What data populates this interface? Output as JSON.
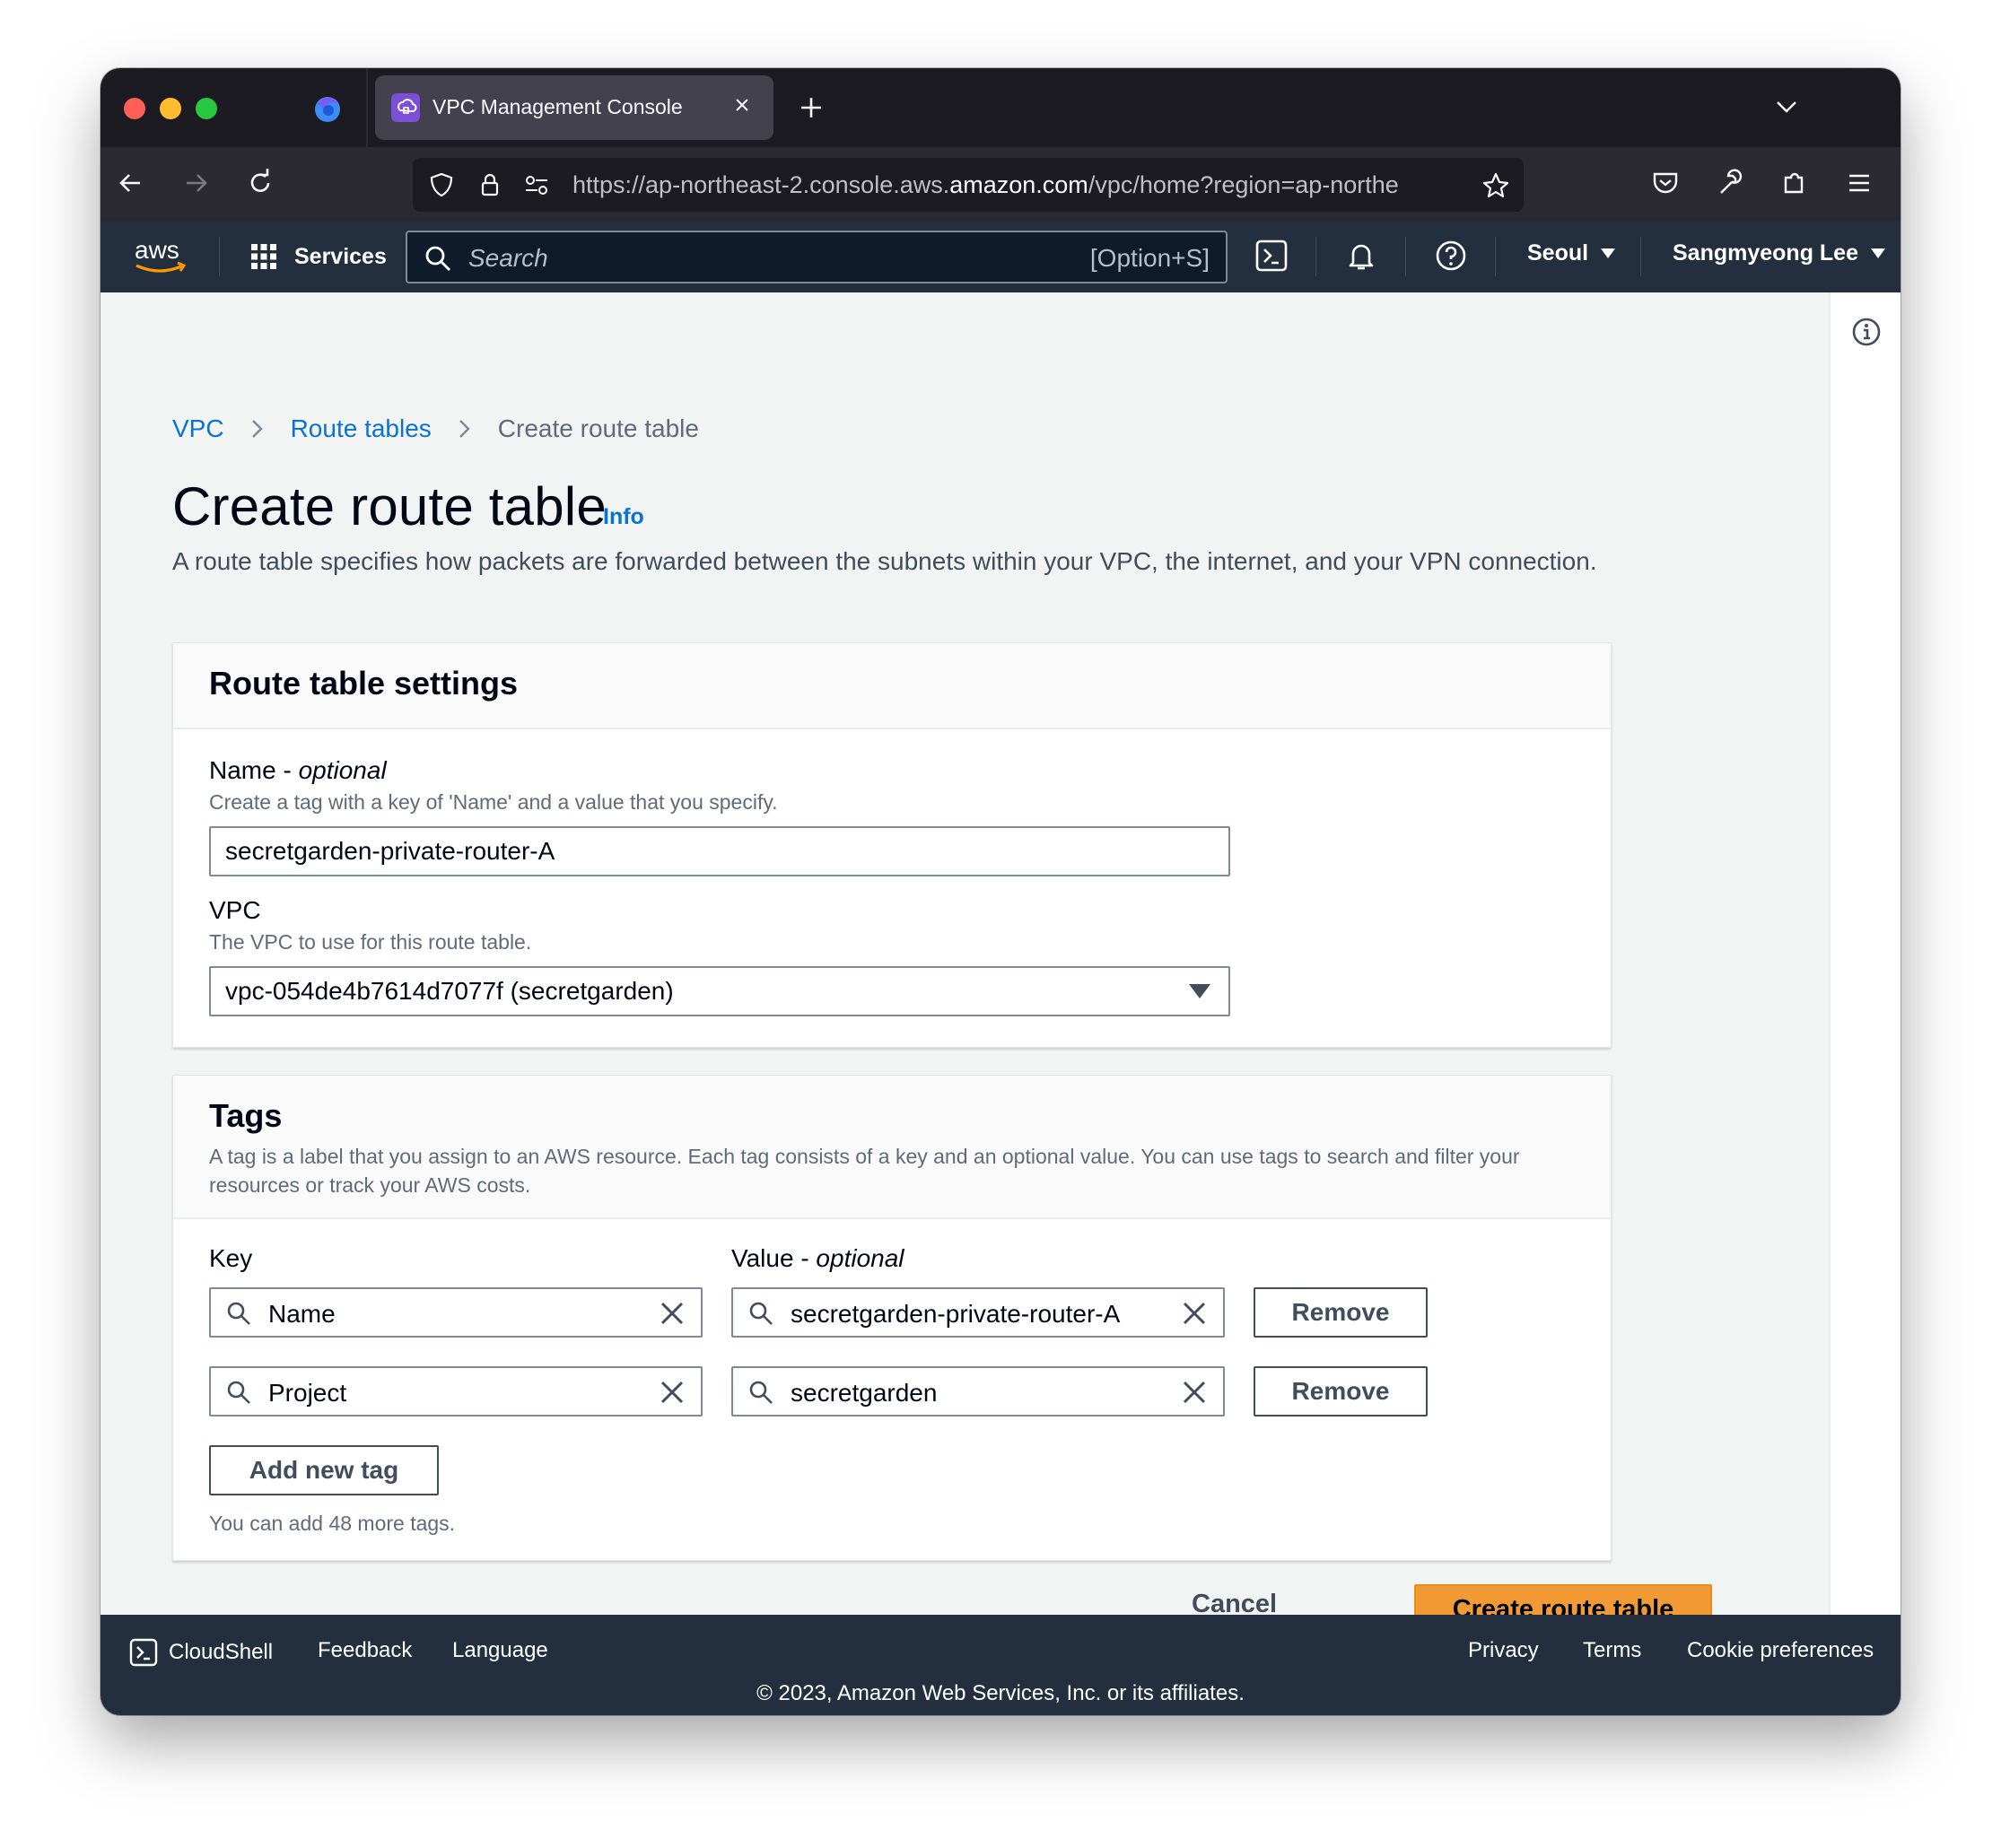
{
  "browser": {
    "tab_title": "VPC Management Console",
    "url_prefix": "https://ap-northeast-2.console.aws.",
    "url_domain": "amazon.com",
    "url_suffix": "/vpc/home?region=ap-northe"
  },
  "aws_header": {
    "logo_text": "aws",
    "services_label": "Services",
    "search_placeholder": "Search",
    "search_shortcut": "[Option+S]",
    "region": "Seoul",
    "user": "Sangmyeong Lee"
  },
  "breadcrumb": {
    "items": [
      "VPC",
      "Route tables",
      "Create route table"
    ]
  },
  "page": {
    "title": "Create route table",
    "info_label": "Info",
    "description": "A route table specifies how packets are forwarded between the subnets within your VPC, the internet, and your VPN connection."
  },
  "settings": {
    "title": "Route table settings",
    "name_label": "Name - ",
    "name_label_optional": "optional",
    "name_desc": "Create a tag with a key of 'Name' and a value that you specify.",
    "name_value": "secretgarden-private-router-A",
    "vpc_label": "VPC",
    "vpc_desc": "The VPC to use for this route table.",
    "vpc_value": "vpc-054de4b7614d7077f (secretgarden)"
  },
  "tags": {
    "title": "Tags",
    "description": "A tag is a label that you assign to an AWS resource. Each tag consists of a key and an optional value. You can use tags to search and filter your resources or track your AWS costs.",
    "key_header": "Key",
    "value_header": "Value - ",
    "value_header_optional": "optional",
    "rows": [
      {
        "key": "Name",
        "value": "secretgarden-private-router-A",
        "remove_label": "Remove"
      },
      {
        "key": "Project",
        "value": "secretgarden",
        "remove_label": "Remove"
      }
    ],
    "add_label": "Add new tag",
    "limit_note": "You can add 48 more tags."
  },
  "actions": {
    "cancel_label": "Cancel",
    "create_label": "Create route table"
  },
  "footer": {
    "cloudshell": "CloudShell",
    "feedback": "Feedback",
    "language": "Language",
    "privacy": "Privacy",
    "terms": "Terms",
    "cookies": "Cookie preferences",
    "copyright": "© 2023, Amazon Web Services, Inc. or its affiliates."
  },
  "colors": {
    "aws_nav": "#232f3e",
    "link_blue": "#0972d3",
    "primary_orange": "#f29a34",
    "browser_dark": "#1c1b22"
  }
}
